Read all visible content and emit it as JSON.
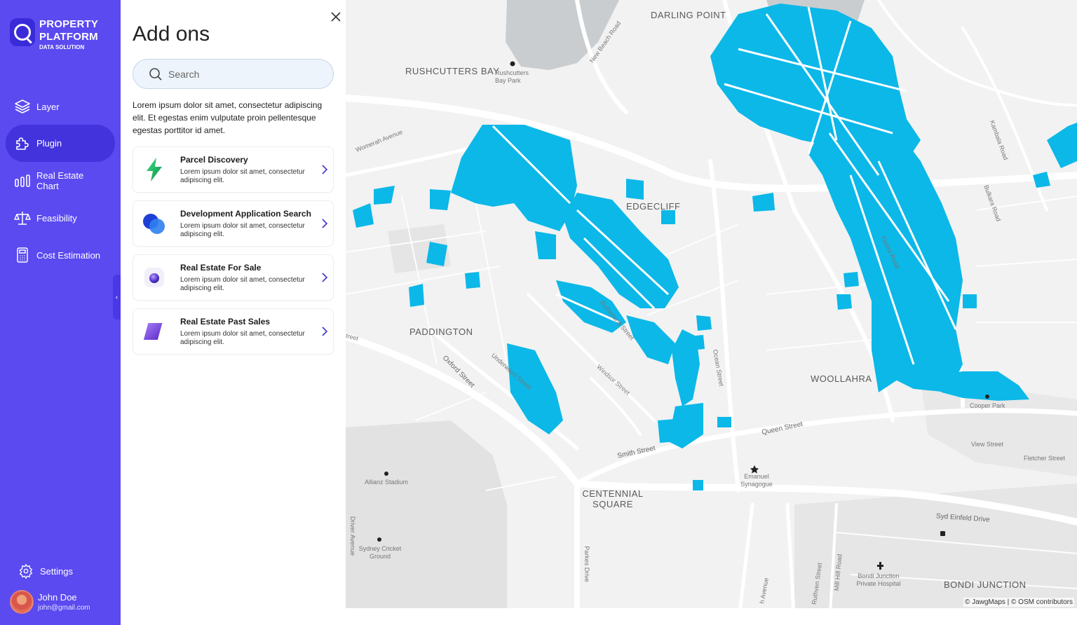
{
  "brand": {
    "title": "PROPERTY PLATFORM",
    "subtitle": "DATA SOLUTION"
  },
  "nav": {
    "items": [
      {
        "label": "Layer",
        "icon": "layers-icon"
      },
      {
        "label": "Plugin",
        "icon": "puzzle-icon",
        "active": true
      },
      {
        "label": "Real Estate Chart",
        "icon": "bar-chart-icon"
      },
      {
        "label": "Feasibility",
        "icon": "scale-icon"
      },
      {
        "label": "Cost Estimation",
        "icon": "calculator-icon"
      }
    ],
    "settings_label": "Settings"
  },
  "user": {
    "name": "John Doe",
    "email": "john@gmail.com"
  },
  "panel": {
    "title": "Add ons",
    "search_placeholder": "Search",
    "description": "Lorem ipsum dolor sit amet, consectetur adipiscing elit. Et egestas enim vulputate proin pellentesque egestas porttitor id amet.",
    "cards": [
      {
        "title": "Parcel Discovery",
        "desc": "Lorem ipsum dolor sit amet, consectetur adipiscing elit.",
        "icon": "bolt-icon"
      },
      {
        "title": "Development Application Search",
        "desc": "Lorem ipsum dolor sit amet, consectetur adipiscing elit.",
        "icon": "overlap-circles-icon"
      },
      {
        "title": "Real Estate For Sale",
        "desc": "Lorem ipsum dolor sit amet, consectetur adipiscing elit.",
        "icon": "sphere-icon"
      },
      {
        "title": "Real Estate Past Sales",
        "desc": "Lorem ipsum dolor sit amet, consectetur adipiscing elit.",
        "icon": "cube-icon"
      }
    ]
  },
  "map": {
    "labels": {
      "darling_point": "DARLING POINT",
      "rushcutters_bay": "RUSHCUTTERS BAY",
      "rushcutters_park": "Rushcutters Bay Park",
      "new_beach_road": "New Beach Road",
      "womerah_avenue": "Womerah Avenue",
      "edgecliff": "EDGECLIFF",
      "paddington": "PADDINGTON",
      "oxford_street": "Oxford Street",
      "underwood_street": "Underwood Street",
      "sutherland_street": "Sutherland Street",
      "windsor_street": "Windsor Street",
      "ocean_street": "Ocean Street",
      "woollahra": "WOOLLAHRA",
      "kambala_road": "Kambala Road",
      "bulkara_road": "Bulkara Road",
      "kiaora_road": "Kiaora Road",
      "cooper_park": "Cooper Park",
      "view_street": "View Street",
      "fletcher_street": "Fletcher Street",
      "queen_street": "Queen Street",
      "smith_street": "Smith Street",
      "emanuel_synagogue": "Emanuel Synagogue",
      "allianz_stadium": "Allianz Stadium",
      "centennial_square": "CENTENNIAL SQUARE",
      "syd_einfeld_drive": "Syd Einfeld Drive",
      "sydney_cricket_ground": "Sydney Cricket Ground",
      "driver_avenue": "Driver Avenue",
      "parkes_drive": "Parkes Drive",
      "ruthven_street": "Ruthven Street",
      "mill_hill_road": "Mill Hill Road",
      "bondi_junction_hospital": "Bondi Junction Private Hospital",
      "bondi_junction": "BONDI JUNCTION",
      "avenue": "h Avenue",
      "street_fragment": "treet"
    },
    "attribution": "© JawgMaps | © OSM contributors",
    "highlight_color": "#0bb8e8"
  }
}
